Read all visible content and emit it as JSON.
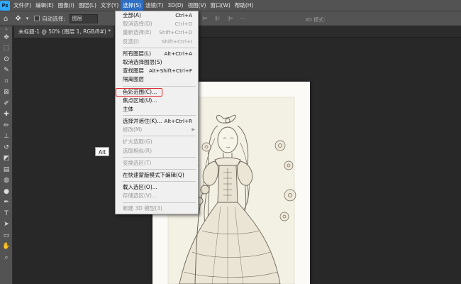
{
  "menubar": {
    "logo": "Ps",
    "items": [
      "文件(F)",
      "编辑(E)",
      "图像(I)",
      "图层(L)",
      "文字(Y)",
      "选择(S)",
      "滤镜(T)",
      "3D(D)",
      "视图(V)",
      "窗口(W)",
      "帮助(H)"
    ],
    "active_index": 5
  },
  "options": {
    "auto_select_label": "自动选择:",
    "layer_select_value": "图层",
    "mode_3d_label": "3D 模式:"
  },
  "document_tab": {
    "label": "未标题-1 @ 50% (图层 1, RGB/8#) *",
    "close_glyph": "×"
  },
  "tooltip": {
    "text": "Alt"
  },
  "select_menu": {
    "items": [
      {
        "label": "全部(A)",
        "shortcut": "Ctrl+A",
        "disabled": false
      },
      {
        "label": "取消选择(D)",
        "shortcut": "Ctrl+D",
        "disabled": true
      },
      {
        "label": "重新选择(E)",
        "shortcut": "Shift+Ctrl+D",
        "disabled": true
      },
      {
        "label": "反选(I)",
        "shortcut": "Shift+Ctrl+I",
        "disabled": true
      },
      {
        "sep": true
      },
      {
        "label": "所有图层(L)",
        "shortcut": "Alt+Ctrl+A",
        "disabled": false
      },
      {
        "label": "取消选择图层(S)",
        "shortcut": "",
        "disabled": false
      },
      {
        "label": "查找图层",
        "shortcut": "Alt+Shift+Ctrl+F",
        "disabled": false
      },
      {
        "label": "隔离图层",
        "shortcut": "",
        "disabled": false
      },
      {
        "sep": true
      },
      {
        "label": "色彩范围(C)...",
        "shortcut": "",
        "disabled": false,
        "highlight": true
      },
      {
        "label": "焦点区域(U)...",
        "shortcut": "",
        "disabled": false
      },
      {
        "label": "主体",
        "shortcut": "",
        "disabled": false
      },
      {
        "sep": true
      },
      {
        "label": "选择并遮住(K)...",
        "shortcut": "Alt+Ctrl+R",
        "disabled": false
      },
      {
        "label": "修改(M)",
        "shortcut": "",
        "disabled": true,
        "submenu": true
      },
      {
        "sep": true
      },
      {
        "label": "扩大选取(G)",
        "shortcut": "",
        "disabled": true
      },
      {
        "label": "选取相似(R)",
        "shortcut": "",
        "disabled": true
      },
      {
        "sep": true
      },
      {
        "label": "变换选区(T)",
        "shortcut": "",
        "disabled": true
      },
      {
        "sep": true
      },
      {
        "label": "在快速蒙版模式下编辑(Q)",
        "shortcut": "",
        "disabled": false
      },
      {
        "sep": true
      },
      {
        "label": "载入选区(O)...",
        "shortcut": "",
        "disabled": false
      },
      {
        "label": "存储选区(V)...",
        "shortcut": "",
        "disabled": true
      },
      {
        "sep": true
      },
      {
        "label": "新建 3D 模型(3)",
        "shortcut": "",
        "disabled": true
      }
    ]
  },
  "colors": {
    "app_bg": "#282828",
    "panel": "#535353",
    "menu_active": "#2e6fc4",
    "highlight_box": "#e0262d"
  }
}
